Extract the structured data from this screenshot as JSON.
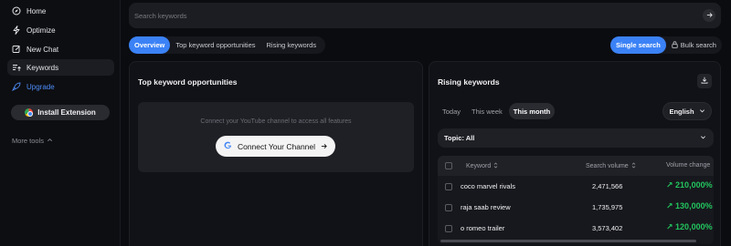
{
  "sidebar": {
    "items": [
      {
        "label": "Home",
        "icon": "compass-icon"
      },
      {
        "label": "Optimize",
        "icon": "lightning-icon"
      },
      {
        "label": "New Chat",
        "icon": "edit-icon"
      },
      {
        "label": "Keywords",
        "icon": "keyword-list-icon"
      },
      {
        "label": "Upgrade",
        "icon": "rocket-icon"
      }
    ],
    "install_label": "Install Extension",
    "more_tools_label": "More tools"
  },
  "search": {
    "placeholder": "Search keywords"
  },
  "tabs": [
    "Overview",
    "Top keyword opportunities",
    "Rising keywords"
  ],
  "modes": {
    "single": "Single search",
    "bulk": "Bulk search"
  },
  "left_card": {
    "title": "Top keyword opportunities",
    "connect_text": "Connect your YouTube channel to access all features",
    "connect_button": "Connect Your Channel"
  },
  "right_card": {
    "title": "Rising keywords",
    "ranges": [
      "Today",
      "This week",
      "This month"
    ],
    "language": "English",
    "topic": "Topic: All",
    "columns": {
      "keyword": "Keyword",
      "volume": "Search volume",
      "change": "Volume change"
    },
    "rows": [
      {
        "keyword": "coco marvel rivals",
        "volume": "2,471,566",
        "change": "210,000%"
      },
      {
        "keyword": "raja saab review",
        "volume": "1,735,975",
        "change": "130,000%"
      },
      {
        "keyword": "o romeo trailer",
        "volume": "3,573,402",
        "change": "120,000%"
      }
    ]
  },
  "colors": {
    "accent": "#3b82f6",
    "positive": "#22c55e",
    "background": "#0b0c10"
  }
}
